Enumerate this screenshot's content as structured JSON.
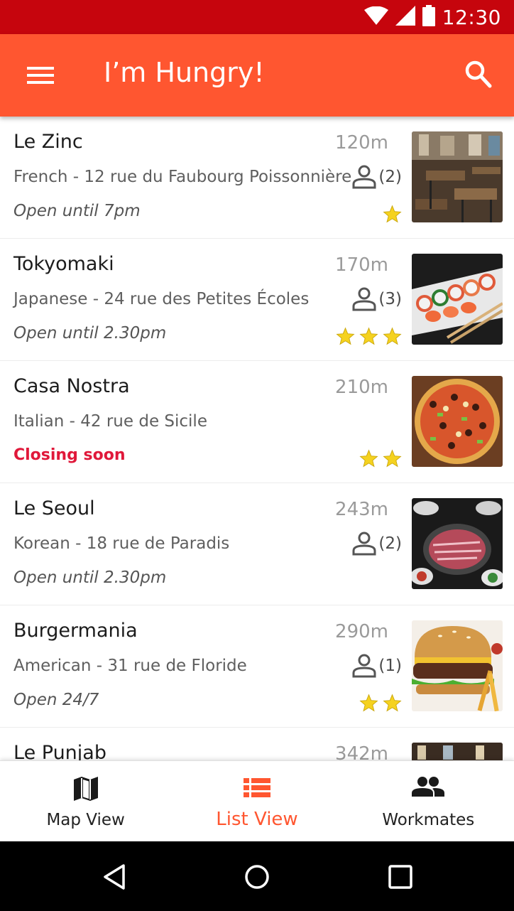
{
  "status_bar": {
    "time": "12:30"
  },
  "app_bar": {
    "title": "I’m Hungry!",
    "menu_icon": "menu-icon",
    "search_icon": "search-icon"
  },
  "colors": {
    "primary": "#ff5630",
    "status_bar": "#c6050d",
    "closing": "#e0183a",
    "star": "#f5d21f"
  },
  "restaurants": [
    {
      "name": "Le Zinc",
      "distance": "120m",
      "address": "French - 12 rue du Faubourg Poissonnière",
      "hours": "Open until 7pm",
      "closing_soon": false,
      "workmates": "(2)",
      "rating": 1,
      "photo": "bistro-interior"
    },
    {
      "name": "Tokyomaki",
      "distance": "170m",
      "address": "Japanese - 24 rue des Petites Écoles",
      "hours": "Open until 2.30pm",
      "closing_soon": false,
      "workmates": "(3)",
      "rating": 3,
      "photo": "sushi"
    },
    {
      "name": "Casa Nostra",
      "distance": "210m",
      "address": "Italian - 42 rue de Sicile",
      "hours": "Closing soon",
      "closing_soon": true,
      "workmates": "",
      "rating": 2,
      "photo": "pizza"
    },
    {
      "name": "Le Seoul",
      "distance": "243m",
      "address": "Korean - 18 rue de Paradis",
      "hours": "Open until 2.30pm",
      "closing_soon": false,
      "workmates": "(2)",
      "rating": 0,
      "photo": "korean-bbq"
    },
    {
      "name": "Burgermania",
      "distance": "290m",
      "address": "American - 31 rue de Floride",
      "hours": "Open 24/7",
      "closing_soon": false,
      "workmates": "(1)",
      "rating": 2,
      "photo": "burger"
    },
    {
      "name": "Le Punjab",
      "distance": "342m",
      "address": "",
      "hours": "",
      "closing_soon": false,
      "workmates": "",
      "rating": 0,
      "photo": "restaurant"
    }
  ],
  "bottom_nav": {
    "items": [
      {
        "label": "Map View",
        "icon": "map-icon",
        "active": false
      },
      {
        "label": "List View",
        "icon": "list-icon",
        "active": true
      },
      {
        "label": "Workmates",
        "icon": "people-icon",
        "active": false
      }
    ]
  }
}
